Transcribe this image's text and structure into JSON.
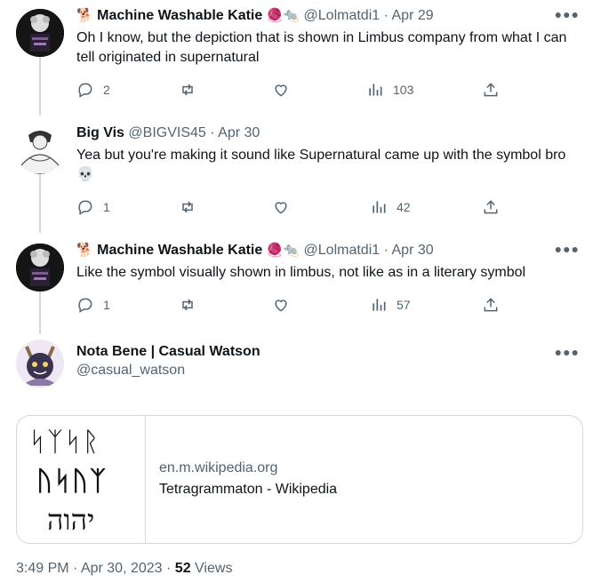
{
  "tweets": [
    {
      "name": "Machine Washable Katie",
      "prefix_emoji": "🐕",
      "suffix_emoji": "🧶🐀",
      "handle": "@Lolmatdi1",
      "date": "Apr 29",
      "text": "Oh I know, but the depiction that is shown in Limbus company from what I can tell originated in supernatural",
      "replies": "2",
      "views": "103"
    },
    {
      "name": "Big Vis",
      "handle": "@BIGVIS45",
      "date": "Apr 30",
      "text": "Yea but you're making it sound like Supernatural came up with the symbol bro 💀",
      "replies": "1",
      "views": "42"
    },
    {
      "name": "Machine Washable Katie",
      "prefix_emoji": "🐕",
      "suffix_emoji": "🧶🐀",
      "handle": "@Lolmatdi1",
      "date": "Apr 30",
      "text": "Like the symbol visually shown in limbus, not like as in a literary symbol",
      "replies": "1",
      "views": "57"
    }
  ],
  "focused": {
    "name": "Nota Bene | Casual Watson",
    "handle": "@casual_watson",
    "card": {
      "domain": "en.m.wikipedia.org",
      "title": "Tetragrammaton - Wikipedia",
      "image_line1": "ᛋᛉᛋᚱ",
      "image_line2": "ᚢᛋᚢᛉ",
      "image_line3": "יהוה"
    },
    "time": "3:49 PM",
    "date": "Apr 30, 2023",
    "views_count": "52",
    "views_label": "Views"
  },
  "separator": "·",
  "colors": {
    "text": "#0f1419",
    "secondary": "#536471",
    "border": "#cfd9de",
    "link_blue": "#1d9bf0"
  },
  "icons": [
    "reply-icon",
    "retweet-icon",
    "like-icon",
    "views-icon",
    "share-icon",
    "more-icon"
  ]
}
